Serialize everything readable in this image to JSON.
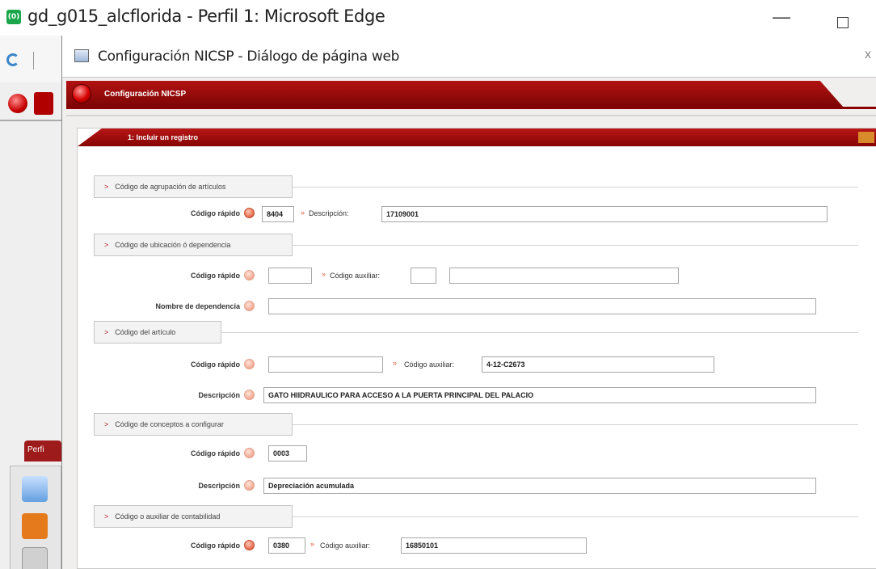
{
  "browser": {
    "window_title": "gd_g015_alcflorida - Perfil 1: Microsoft Edge",
    "app_icon_text": "(0)",
    "minimize_glyph": "—"
  },
  "dialog": {
    "window_title": "Configuración NICSP - Diálogo de página web",
    "close_glyph": "x",
    "header_title": "Configuración NICSP",
    "panel_title": "1: Incluir un registro"
  },
  "left_strip": {
    "tab_label": "Perfi"
  },
  "sections": {
    "agrupacion": {
      "title": "Código de agrupación de artículos",
      "codigo_rapido_label": "Código rápido",
      "codigo_rapido_value": "8404",
      "descripcion_label": "Descripción:",
      "descripcion_value": "17109001"
    },
    "ubicacion": {
      "title": "Código de ubicación ó dependencia",
      "codigo_rapido_label": "Código rápido",
      "codigo_rapido_value": "",
      "codigo_auxiliar_label": "Código auxiliar:",
      "codigo_auxiliar_value": "",
      "codigo_auxiliar_desc_value": "",
      "nombre_dependencia_label": "Nombre de dependencia",
      "nombre_dependencia_value": ""
    },
    "articulo": {
      "title": "Código del artículo",
      "codigo_rapido_label": "Código rápido",
      "codigo_rapido_value": "",
      "codigo_auxiliar_label": "Código auxiliar:",
      "codigo_auxiliar_value": "4-12-C2673",
      "descripcion_label": "Descripción",
      "descripcion_value": "GATO HIIDRAULICO PARA ACCESO A LA PUERTA PRINCIPAL DEL PALACIO"
    },
    "conceptos": {
      "title": "Código de conceptos a configurar",
      "codigo_rapido_label": "Código rápido",
      "codigo_rapido_value": "0003",
      "descripcion_label": "Descripción",
      "descripcion_value": "Depreciación acumulada"
    },
    "contabilidad": {
      "title": "Código o auxiliar de contabilidad",
      "codigo_rapido_label": "Código rápido",
      "codigo_rapido_value": "0380",
      "codigo_auxiliar_label": "Código auxiliar:",
      "codigo_auxiliar_value": "16850101"
    }
  },
  "symbols": {
    "arrow": ">",
    "star": "»"
  }
}
